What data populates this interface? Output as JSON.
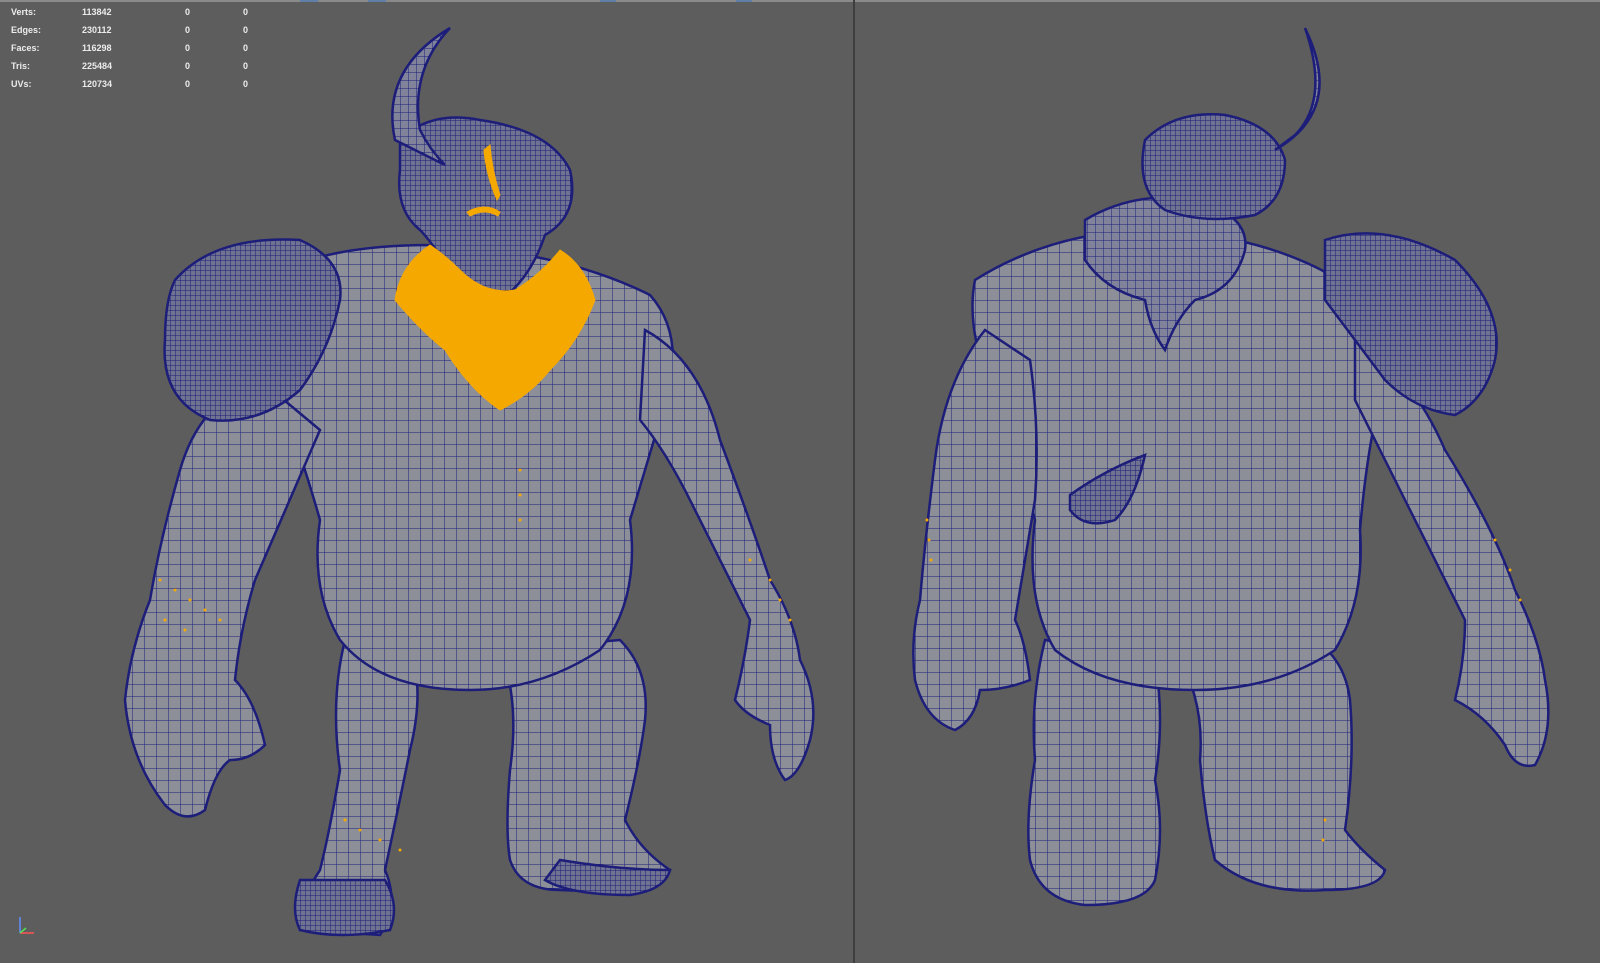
{
  "hud": {
    "rows": [
      {
        "label": "Verts:",
        "value": "113842",
        "selected": "0",
        "uv": "0"
      },
      {
        "label": "Edges:",
        "value": "230112",
        "selected": "0",
        "uv": "0"
      },
      {
        "label": "Faces:",
        "value": "116298",
        "selected": "0",
        "uv": "0"
      },
      {
        "label": "Tris:",
        "value": "225484",
        "selected": "0",
        "uv": "0"
      },
      {
        "label": "UVs:",
        "value": "120734",
        "selected": "0",
        "uv": "0"
      }
    ]
  },
  "colors": {
    "background": "#5d5d5d",
    "wireframe": "#1d1d7a",
    "surface": "#8c8f97",
    "selection": "#f5a800"
  },
  "icons": {
    "axis": "xyz-axis-gizmo-icon"
  }
}
